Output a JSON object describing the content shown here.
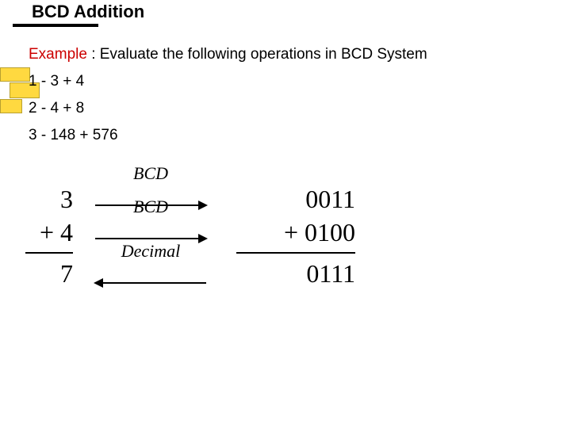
{
  "title": "BCD Addition",
  "example_label": "Example",
  "example_rest": " : Evaluate the following operations in BCD System",
  "items": {
    "l1": "1 - 3 + 4",
    "l2": "2 - 4 + 8",
    "l3": "3 - 148 + 576"
  },
  "math": {
    "left_a": "3",
    "left_b": "+ 4",
    "left_sum": "7",
    "right_a": "0011",
    "right_b": "+  0100",
    "right_sum": "0111",
    "label_bcd": "BCD",
    "label_decimal": "Decimal"
  }
}
